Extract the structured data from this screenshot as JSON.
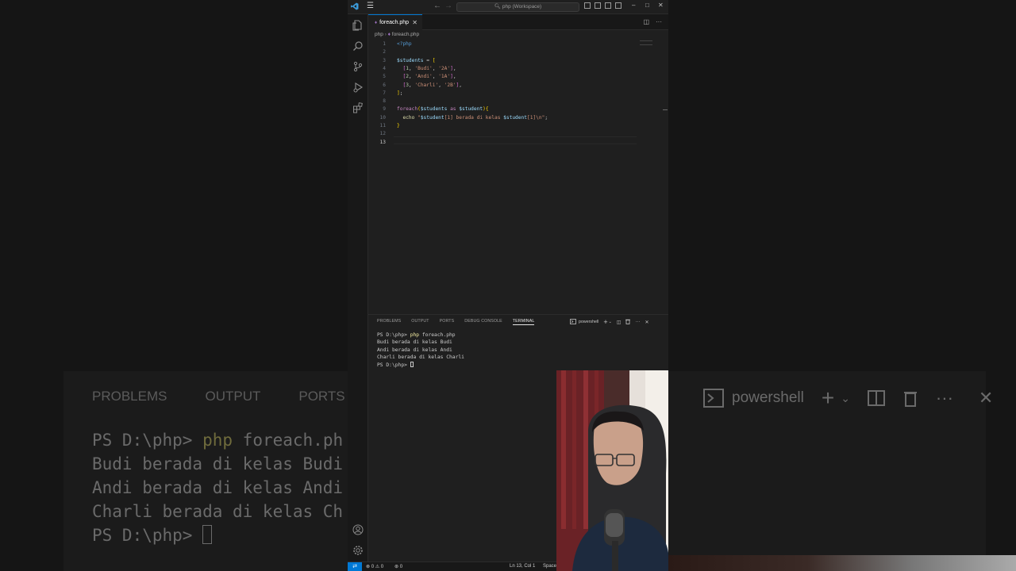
{
  "window": {
    "command_center": "php (Workspace)"
  },
  "editor": {
    "tab_label": "foreach.php",
    "breadcrumb": {
      "folder": "php",
      "file": "foreach.php"
    },
    "current_line": 13
  },
  "panel": {
    "tabs": [
      "PROBLEMS",
      "OUTPUT",
      "PORTS",
      "DEBUG CONSOLE",
      "TERMINAL"
    ],
    "active_tab": "TERMINAL",
    "terminal_name": "powershell",
    "terminal": {
      "prompt": "PS D:\\php> ",
      "command_exe": "php",
      "command_args": " foreach.php",
      "output": [
        "Budi berada di kelas Budi",
        "Andi berada di kelas Andi",
        "Charli berada di kelas Charli"
      ]
    }
  },
  "status": {
    "errors": "0",
    "warnings": "0",
    "ports": "0",
    "position": "Ln 13, Col 1",
    "indent": "Space"
  },
  "background": {
    "tabs": [
      "PROBLEMS",
      "OUTPUT",
      "PORTS"
    ],
    "cmd_full": "foreach.ph",
    "lines": [
      "Budi berada di kelas Budi",
      "Andi berada di kelas Andi",
      "Charli berada di kelas Ch"
    ],
    "terminal_name": "powershell"
  },
  "colors": {
    "accent": "#0078d4",
    "php_icon": "#a074c4",
    "terminal_exe": "#f9f1a5"
  }
}
